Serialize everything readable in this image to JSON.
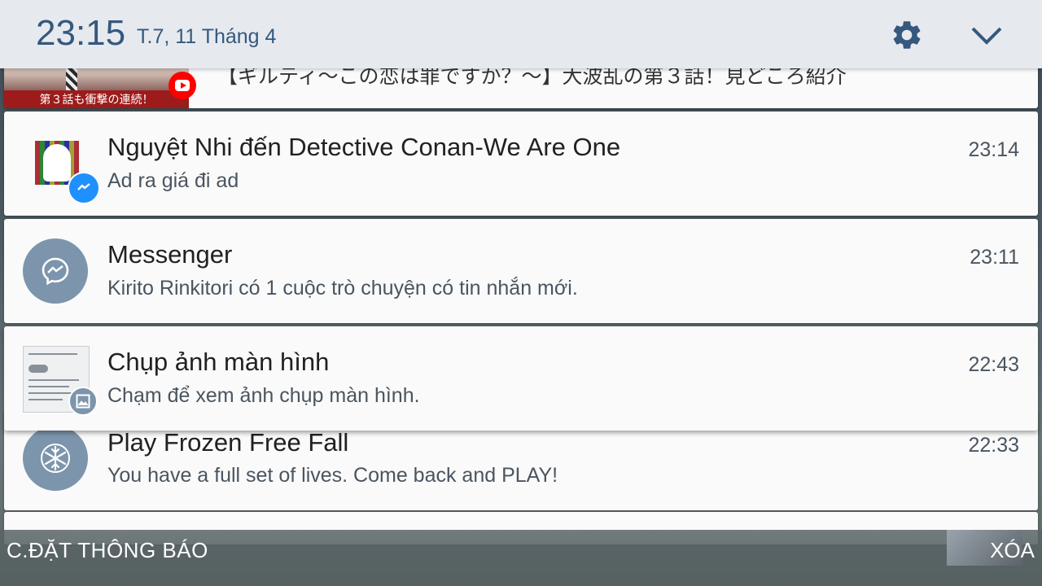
{
  "status_bar": {
    "time": "23:15",
    "date": "T.7, 11 Tháng 4"
  },
  "notifications": [
    {
      "app": "YouTube",
      "thumbnail_caption": "第３話も衝撃の連続！",
      "title": "【ギルティ～この恋は罪ですか？～】大波乱の第３話！見どころ紹介"
    },
    {
      "app": "Messenger",
      "title": "Nguyệt Nhi đến Detective Conan-We Are One",
      "body": "Ad ra giá đi ad",
      "time": "23:14"
    },
    {
      "app": "Messenger",
      "title": "Messenger",
      "body": "Kirito Rinkitori có 1 cuộc trò chuyện có tin nhắn mới.",
      "time": "23:11"
    },
    {
      "app": "Screenshot",
      "title": "Chụp ảnh màn hình",
      "body": "Chạm để xem ảnh chụp màn hình.",
      "time": "22:43"
    },
    {
      "app": "Frozen Free Fall",
      "title": "Play Frozen Free Fall",
      "body": "You have a full set of lives. Come back and PLAY!",
      "time": "22:33"
    }
  ],
  "footer": {
    "settings_label": "C.ĐẶT THÔNG BÁO",
    "clear_label": "XÓA"
  },
  "colors": {
    "header_bg": "#e6eaee",
    "header_text": "#35587e",
    "icon_circle": "#7c95ac",
    "messenger_blue": "#1e90ff",
    "youtube_red": "#ff0000"
  },
  "icons": [
    "gear-icon",
    "chevron-down-icon",
    "youtube-icon",
    "messenger-icon",
    "snowflake-icon",
    "image-icon"
  ]
}
